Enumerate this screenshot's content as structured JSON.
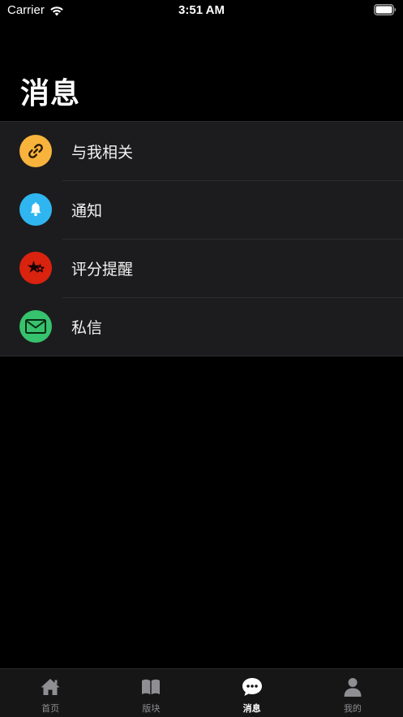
{
  "status_bar": {
    "carrier": "Carrier",
    "time": "3:51 AM"
  },
  "page": {
    "title": "消息"
  },
  "list": {
    "items": [
      {
        "label": "与我相关",
        "icon": "link-icon",
        "color": "#f7b33c"
      },
      {
        "label": "通知",
        "icon": "bell-icon",
        "color": "#2fb6f0"
      },
      {
        "label": "评分提醒",
        "icon": "star-icon",
        "color": "#d9230f"
      },
      {
        "label": "私信",
        "icon": "mail-icon",
        "color": "#37c26d"
      }
    ]
  },
  "tab_bar": {
    "tabs": [
      {
        "label": "首页",
        "icon": "home-icon",
        "active": false
      },
      {
        "label": "版块",
        "icon": "book-icon",
        "active": false
      },
      {
        "label": "消息",
        "icon": "chat-bubble-icon",
        "active": true
      },
      {
        "label": "我的",
        "icon": "person-icon",
        "active": false
      }
    ]
  }
}
